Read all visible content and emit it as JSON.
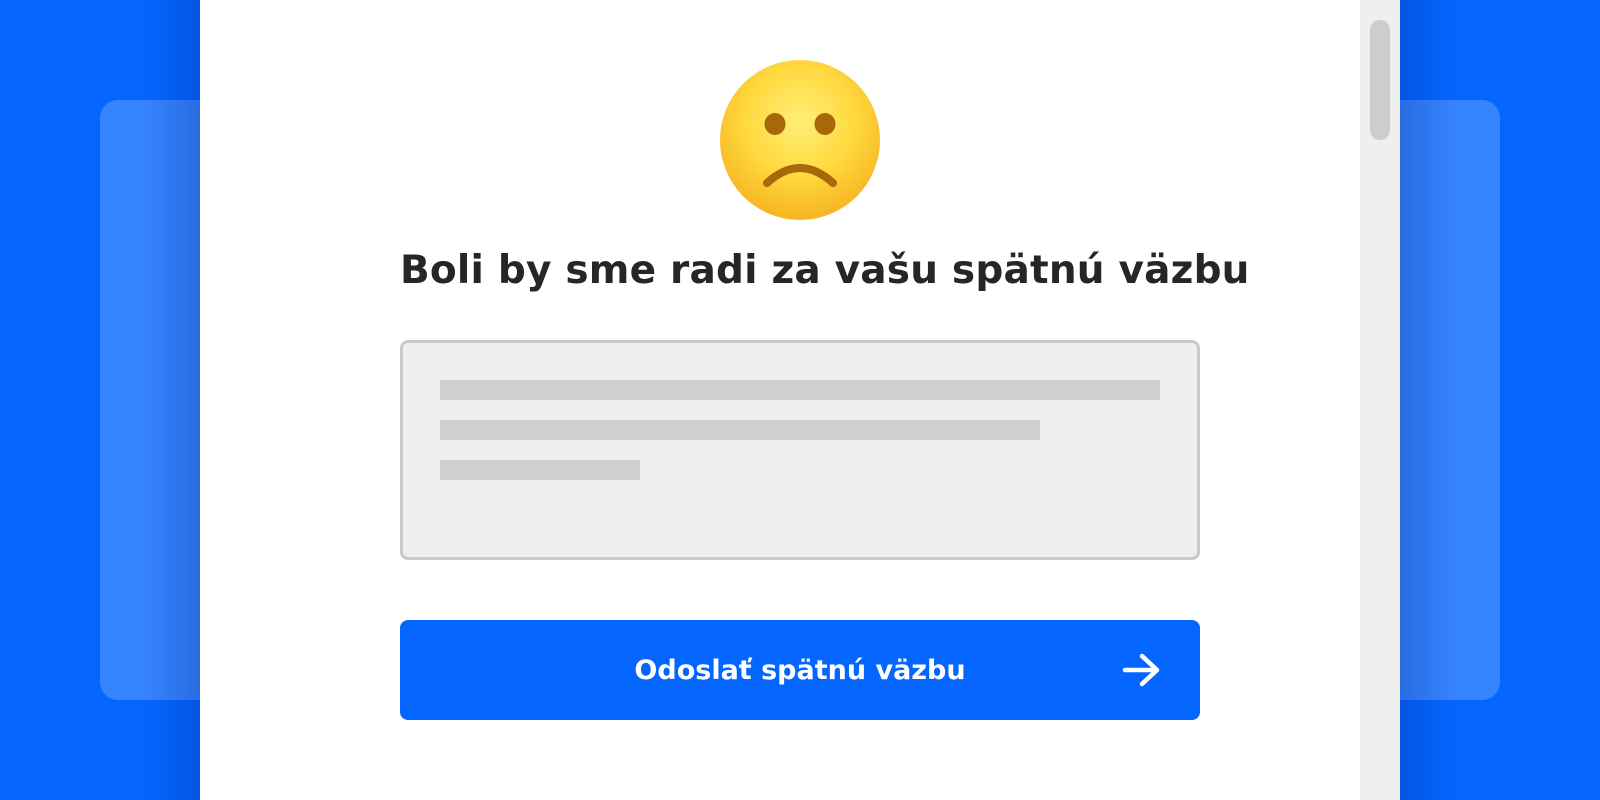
{
  "feedback": {
    "emoji_icon": "frowning-face-icon",
    "title": "Boli by sme radi za vašu spätnú väzbu",
    "text_input": {
      "placeholder": "",
      "value": ""
    },
    "submit": {
      "label": "Odoslať spätnú väzbu",
      "icon": "arrow-right-icon"
    }
  },
  "colors": {
    "brand_blue": "#0566ff",
    "modal_background": "#ffffff",
    "title_text": "#262626",
    "input_background": "#efefef",
    "input_border": "#c9c9c9"
  }
}
